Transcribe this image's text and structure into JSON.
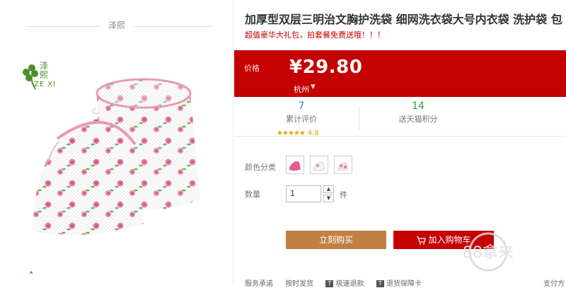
{
  "shop": {
    "name": "泽熙"
  },
  "brand": {
    "name_cn": "泽熙",
    "name_en": "ZE XI"
  },
  "product": {
    "title": "加厚型双层三明治文胸护洗袋 细网洗衣袋大号内衣袋 洗护袋 包邮",
    "subtitle": "超值豪华大礼包，拍套餐免费送哦！！！"
  },
  "price": {
    "label": "价格",
    "value": "¥29.80",
    "location": "杭州"
  },
  "stats": {
    "reviews": {
      "value": "7",
      "label": "累计评价"
    },
    "points": {
      "value": "14",
      "label": "送天猫积分"
    },
    "rating": {
      "stars": "★★★★★",
      "score": "4.8"
    }
  },
  "options": {
    "color_label": "颜色分类",
    "quantity_label": "数量",
    "quantity_value": "1",
    "quantity_unit": "件"
  },
  "actions": {
    "buy_now": "立刻购买",
    "add_to_cart": "加入购物车"
  },
  "services": {
    "label": "服务承诺",
    "items": [
      {
        "badge": "",
        "text": "按时发货"
      },
      {
        "badge": "T",
        "text": "极速退款"
      },
      {
        "badge": "T",
        "text": "退货保障卡"
      }
    ],
    "right_text": "支付方"
  },
  "watermark": {
    "text": "88拿来"
  },
  "colors": {
    "brand_red": "#c40000",
    "buy_button": "#bf8045",
    "link_blue": "#3c86c6",
    "points_green": "#2c9a2c",
    "star": "#e9a000"
  }
}
